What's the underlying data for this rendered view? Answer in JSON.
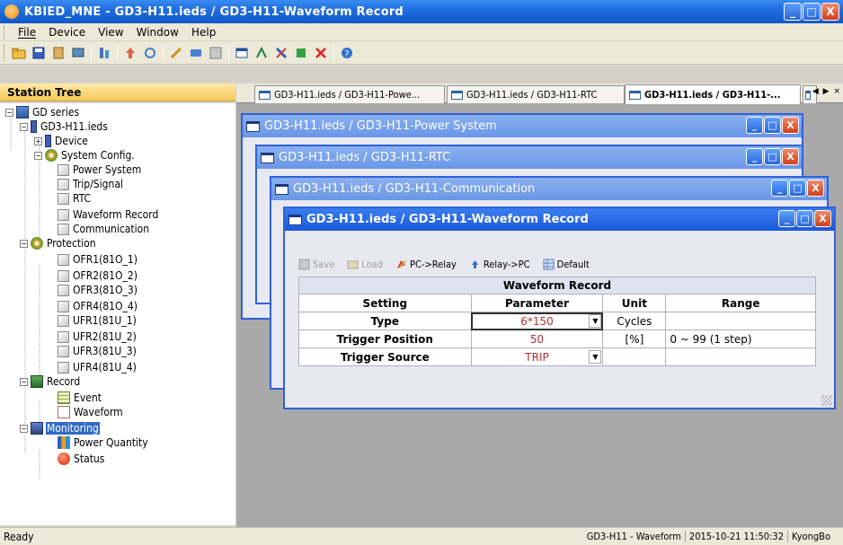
{
  "app": {
    "title": "KBIED_MNE - GD3-H11.ieds / GD3-H11-Waveform Record"
  },
  "window_buttons": {
    "minimize": "_",
    "maximize": "□",
    "close": "X"
  },
  "menu": [
    {
      "label": "File",
      "accel": "F"
    },
    {
      "label": "Device",
      "accel": "D"
    },
    {
      "label": "View",
      "accel": "V"
    },
    {
      "label": "Window",
      "accel": "W"
    },
    {
      "label": "Help",
      "accel": "H"
    }
  ],
  "toolbar": {
    "icons": [
      "open-icon",
      "save-icon",
      "device-icon",
      "network-icon",
      "tree-icon",
      "upload-icon",
      "refresh-icon",
      "connect-icon",
      "disconnect-icon",
      "grid-icon",
      "window-icon",
      "tile-icon",
      "cascade-icon",
      "arrange-icon",
      "close-all-icon",
      "help-icon"
    ]
  },
  "station_tree": {
    "header": "Station Tree",
    "nodes": {
      "gd_series": "GD series",
      "ieds": "GD3-H11.ieds",
      "device": "Device",
      "system_config": "System Config.",
      "power_system": "Power System",
      "trip_signal": "Trip/Signal",
      "rtc": "RTC",
      "waveform_record": "Waveform Record",
      "communication": "Communication",
      "protection": "Protection",
      "ofr1": "OFR1(81O_1)",
      "ofr2": "OFR2(81O_2)",
      "ofr3": "OFR3(81O_3)",
      "ofr4": "OFR4(81O_4)",
      "ufr1": "UFR1(81U_1)",
      "ufr2": "UFR2(81U_2)",
      "ufr3": "UFR3(81U_3)",
      "ufr4": "UFR4(81U_4)",
      "record": "Record",
      "event": "Event",
      "waveform": "Waveform",
      "monitoring": "Monitoring",
      "power_quantity": "Power Quantity",
      "status": "Status"
    }
  },
  "tabs": [
    "GD3-H11.ieds / GD3-H11-Powe...",
    "GD3-H11.ieds / GD3-H11-RTC",
    "GD3-H11.ieds / GD3-H11-..."
  ],
  "tab_nav": "◀ ▶ ×",
  "child_windows": {
    "power_system": "GD3-H11.ieds / GD3-H11-Power System",
    "rtc": "GD3-H11.ieds / GD3-H11-RTC",
    "communication": "GD3-H11.ieds / GD3-H11-Communication",
    "waveform_record": "GD3-H11.ieds / GD3-H11-Waveform Record"
  },
  "record_toolbar": {
    "save": "Save",
    "load": "Load",
    "pc_to_relay": "PC->Relay",
    "relay_to_pc": "Relay->PC",
    "default": "Default"
  },
  "waveform_table": {
    "caption": "Waveform Record",
    "headers": {
      "setting": "Setting",
      "parameter": "Parameter",
      "unit": "Unit",
      "range": "Range"
    },
    "rows": [
      {
        "setting": "Type",
        "parameter": "6*150",
        "unit": "Cycles",
        "range": ""
      },
      {
        "setting": "Trigger Position",
        "parameter": "50",
        "unit": "[%]",
        "range": "0 ~ 99 (1 step)"
      },
      {
        "setting": "Trigger Source",
        "parameter": "TRIP",
        "unit": "",
        "range": ""
      }
    ]
  },
  "status_bar": {
    "left": "Ready",
    "view": "GD3-H11 - Waveform",
    "datetime": "2015-10-21 11:50:32",
    "user": "KyongBo"
  },
  "colors": {
    "title_blue": "#1f6ee0",
    "tree_header": "#f7c85a",
    "selection": "#316ac5",
    "param_red": "#b03030"
  }
}
